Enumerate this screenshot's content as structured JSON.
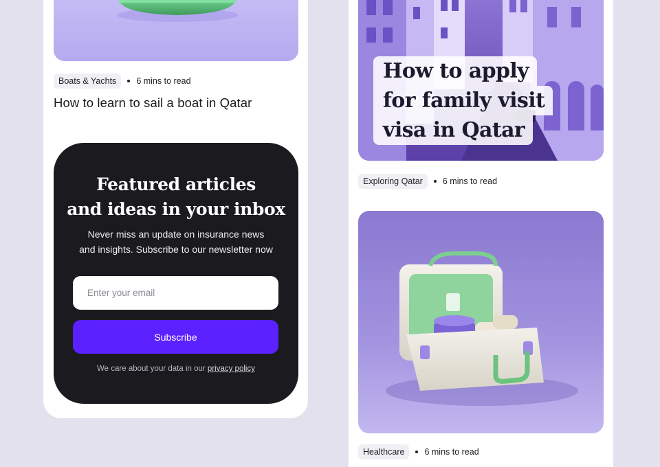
{
  "left_article": {
    "category": "Boats & Yachts",
    "read_time": "6 mins to read",
    "title": "How to learn to sail a boat in Qatar"
  },
  "newsletter": {
    "heading_line1": "Featured articles",
    "heading_line2": "and ideas in your inbox",
    "subtext_line1": "Never miss an update on insurance news",
    "subtext_line2": "and insights. Subscribe to our newsletter now",
    "email_placeholder": "Enter your email",
    "subscribe_label": "Subscribe",
    "privacy_prefix": "We care about your data in our",
    "privacy_link": "privacy policy"
  },
  "right_article_1": {
    "image_title_line1": "How to apply",
    "image_title_line2": "for family visit",
    "image_title_line3": "visa in Qatar",
    "category": "Exploring Qatar",
    "read_time": "6 mins to read"
  },
  "right_article_2": {
    "category": "Healthcare",
    "read_time": "6 mins to read"
  },
  "colors": {
    "page_background": "#e3e1ee",
    "newsletter_background": "#1b1b1f",
    "subscribe_button": "#5b21ff",
    "image_lavender": "#b9aef0"
  }
}
